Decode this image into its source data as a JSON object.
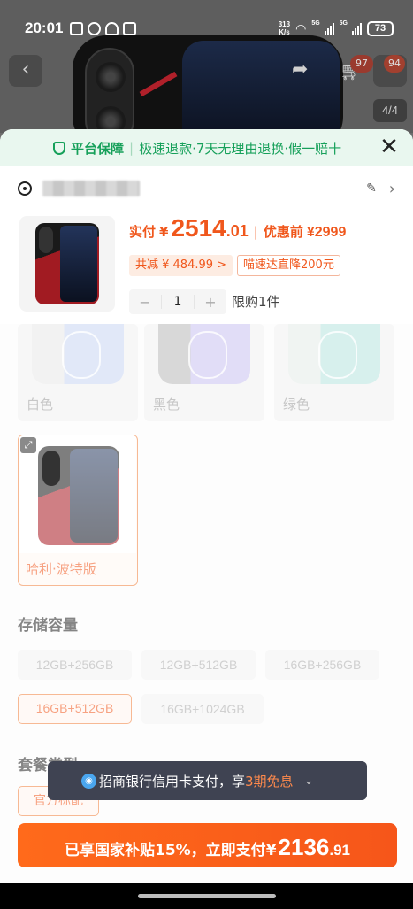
{
  "status_bar": {
    "time": "20:01",
    "net_speed_value": "313",
    "net_speed_unit": "K/s",
    "sig1_tag": "5G",
    "sig2_tag": "5G",
    "battery": "73"
  },
  "background": {
    "cart_badge": "97",
    "more_badge": "94",
    "page_indicator": "4/4"
  },
  "guarantee": {
    "title": "平台保障",
    "separator": "|",
    "items": "极速退款·7天无理由退换·假一赔十"
  },
  "product": {
    "price_label": "实付",
    "currency": "¥",
    "price_int": "2514",
    "price_dec": ".01",
    "price_sep": "|",
    "original_label": "优惠前",
    "original_price": "¥2999",
    "discount_tag": "共减 ¥ 484.99 >",
    "promo_tag": "喵速达直降200元",
    "quantity": "1",
    "qty_minus": "−",
    "qty_plus": "+",
    "limit_text": "限购1件"
  },
  "colors": {
    "white": "白色",
    "black": "黑色",
    "green": "绿色",
    "harry_potter": "哈利·波特版"
  },
  "storage": {
    "title": "存储容量",
    "options": [
      "12GB+256GB",
      "12GB+512GB",
      "16GB+256GB",
      "16GB+512GB",
      "16GB+1024GB"
    ],
    "selected": "16GB+512GB"
  },
  "package": {
    "title": "套餐类型",
    "selected": "官方标配"
  },
  "toast": {
    "text_before": "招商银行信用卡支付，享",
    "highlight": "3期免息",
    "chevron": "⌄"
  },
  "pay_button": {
    "text": "已享国家补贴15%，立即支付",
    "currency": "¥",
    "amount_int": "2136",
    "amount_dec": ".91"
  },
  "accent_color": "#f0571c",
  "guarantee_color": "#16a05a"
}
